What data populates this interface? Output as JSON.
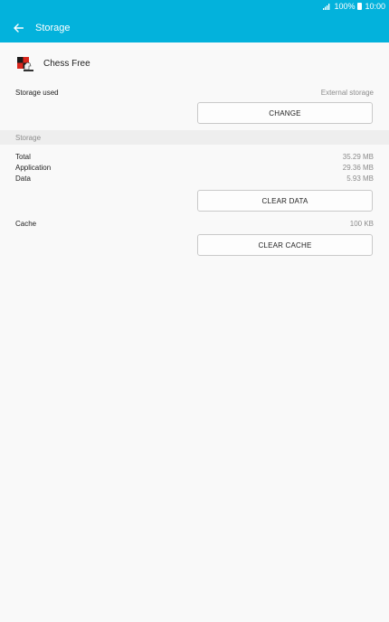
{
  "status": {
    "battery": "100%",
    "time": "10:00"
  },
  "appbar": {
    "title": "Storage"
  },
  "app": {
    "name": "Chess Free"
  },
  "storage_used": {
    "label": "Storage used",
    "value": "External storage",
    "button": "CHANGE"
  },
  "section": {
    "title": "Storage"
  },
  "rows": {
    "total": {
      "label": "Total",
      "value": "35.29 MB"
    },
    "application": {
      "label": "Application",
      "value": "29.36 MB"
    },
    "data": {
      "label": "Data",
      "value": "5.93 MB"
    }
  },
  "clear_data_button": "CLEAR DATA",
  "cache": {
    "label": "Cache",
    "value": "100 KB",
    "button": "CLEAR CACHE"
  },
  "colors": {
    "accent": "#03b2dc",
    "background": "#f9f9f9"
  }
}
